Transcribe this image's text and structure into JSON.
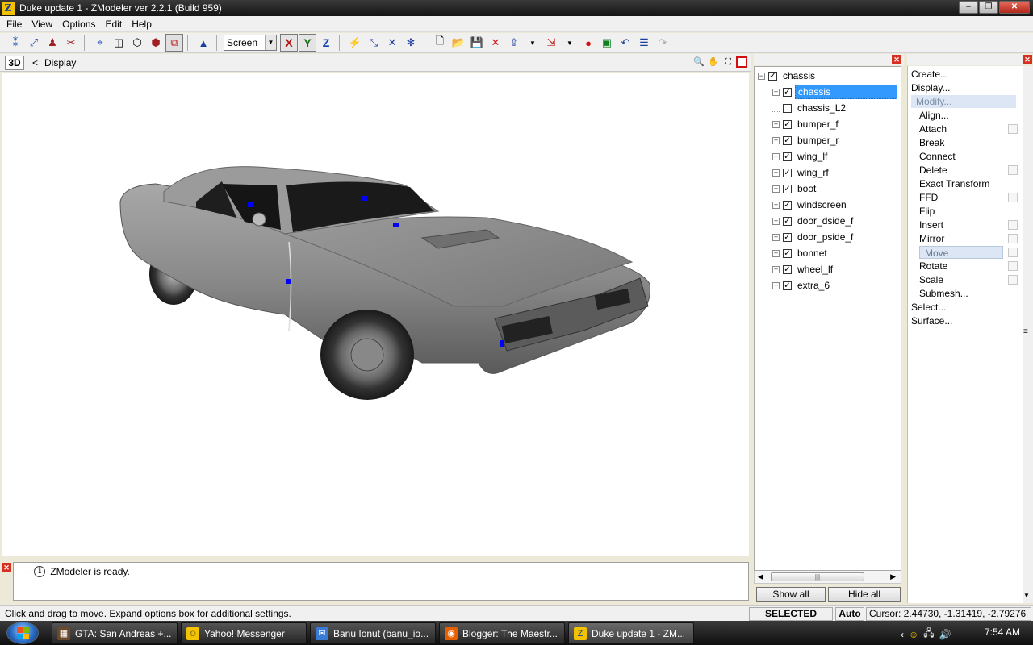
{
  "window": {
    "title": "Duke update 1 - ZModeler ver 2.2.1 (Build 959)",
    "app_icon": "Z"
  },
  "menu": [
    "File",
    "View",
    "Options",
    "Edit",
    "Help"
  ],
  "toolbar": {
    "coord_space": "Screen",
    "axes": [
      "X",
      "Y",
      "Z"
    ]
  },
  "viewport": {
    "mode": "3D",
    "back": "<",
    "title": "Display"
  },
  "console": {
    "message": "ZModeler is ready."
  },
  "status": {
    "message": "Click and drag to move. Expand options box for additional settings.",
    "mode": "SELECTED MODE",
    "snap": "Auto",
    "cursor": "Cursor: 2.44730, -1.31419, -2.79276"
  },
  "tree": {
    "root": "chassis",
    "items": [
      {
        "label": "chassis",
        "checked": true,
        "expandable": true,
        "selected": true
      },
      {
        "label": "chassis_L2",
        "checked": false,
        "expandable": false,
        "selected": false
      },
      {
        "label": "bumper_f",
        "checked": true,
        "expandable": true,
        "selected": false
      },
      {
        "label": "bumper_r",
        "checked": true,
        "expandable": true,
        "selected": false
      },
      {
        "label": "wing_lf",
        "checked": true,
        "expandable": true,
        "selected": false
      },
      {
        "label": "wing_rf",
        "checked": true,
        "expandable": true,
        "selected": false
      },
      {
        "label": "boot",
        "checked": true,
        "expandable": true,
        "selected": false
      },
      {
        "label": "windscreen",
        "checked": true,
        "expandable": true,
        "selected": false
      },
      {
        "label": "door_dside_f",
        "checked": true,
        "expandable": true,
        "selected": false
      },
      {
        "label": "door_pside_f",
        "checked": true,
        "expandable": true,
        "selected": false
      },
      {
        "label": "bonnet",
        "checked": true,
        "expandable": true,
        "selected": false
      },
      {
        "label": "wheel_lf",
        "checked": true,
        "expandable": true,
        "selected": false
      },
      {
        "label": "extra_6",
        "checked": true,
        "expandable": true,
        "selected": false
      }
    ],
    "show_all": "Show all",
    "hide_all": "Hide all"
  },
  "commands": {
    "top": [
      "Create...",
      "Display...",
      "Modify..."
    ],
    "modify_sub": [
      {
        "label": "Align...",
        "options": false
      },
      {
        "label": "Attach",
        "options": true
      },
      {
        "label": "Break",
        "options": false
      },
      {
        "label": "Connect",
        "options": false
      },
      {
        "label": "Delete",
        "options": true
      },
      {
        "label": "Exact Transform",
        "options": false
      },
      {
        "label": "FFD",
        "options": true
      },
      {
        "label": "Flip",
        "options": false
      },
      {
        "label": "Insert",
        "options": true
      },
      {
        "label": "Mirror",
        "options": true
      },
      {
        "label": "Move",
        "options": true
      },
      {
        "label": "Rotate",
        "options": true
      },
      {
        "label": "Scale",
        "options": true
      },
      {
        "label": "Submesh...",
        "options": false
      }
    ],
    "bottom": [
      "Select...",
      "Surface..."
    ],
    "active_command": "Move",
    "active_group": "Modify..."
  },
  "taskbar": {
    "items": [
      {
        "label": "GTA: San Andreas +...",
        "icon": "gta-icon",
        "active": false
      },
      {
        "label": "Yahoo! Messenger",
        "icon": "yahoo-smiley-icon",
        "active": false
      },
      {
        "label": "Banu Ionut (banu_io...",
        "icon": "chat-icon",
        "active": false
      },
      {
        "label": "Blogger: The Maestr...",
        "icon": "firefox-icon",
        "active": false
      },
      {
        "label": "Duke update 1 - ZM...",
        "icon": "zmodeler-icon",
        "active": true
      }
    ],
    "clock": "7:54 AM"
  },
  "colors": {
    "selection": "#3399ff",
    "car_body": "#8c8c8c",
    "vertex_marker": "#0000ff",
    "close_red": "#d83020"
  }
}
